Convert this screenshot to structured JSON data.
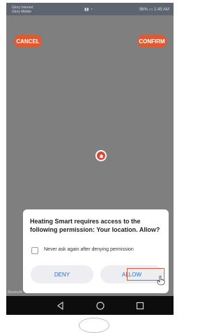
{
  "status_bar": {
    "carrier_line1": "Glory Internet",
    "carrier_line2": "Glory Mobile",
    "time_text": "1:45 AM",
    "battery_text": "96%"
  },
  "header": {
    "cancel_label": "CANCEL",
    "confirm_label": "CONFIRM"
  },
  "dialog": {
    "message": "Heating Smart requires access to the following permission: Your location. Allow?",
    "checkbox_label": "Never ask again after denying permission",
    "checkbox_checked": false,
    "deny_label": "DENY",
    "allow_label": "ALLOW"
  },
  "bottom_label": "Bluetooth",
  "icons": {
    "map_pin": "location-marker-icon",
    "cursor": "pointer-hand-icon",
    "back": "back-triangle-icon",
    "home": "home-circle-icon",
    "recents": "recents-square-icon"
  },
  "colors": {
    "accent": "#e4582e",
    "dialog_text": "#222222",
    "button_text": "#2f6fbf",
    "overlay": "#7f7f7f"
  }
}
